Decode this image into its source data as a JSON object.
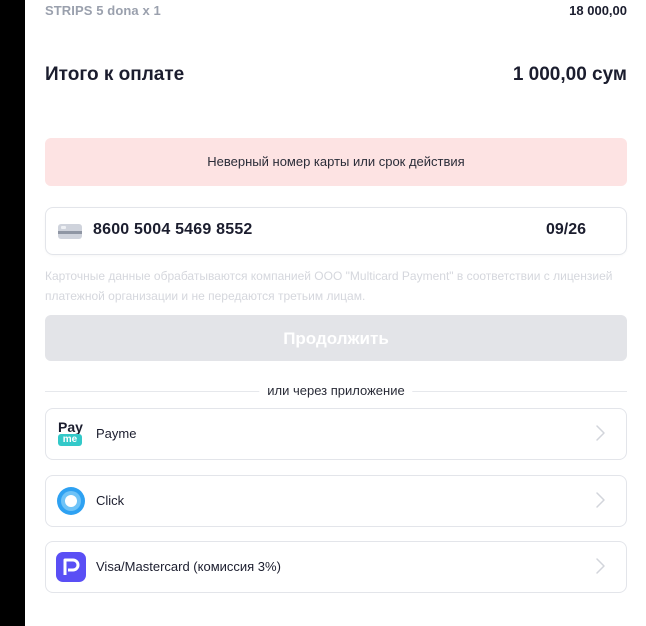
{
  "order": {
    "item_name": "STRIPS 5 dona x 1",
    "item_price": "18 000,00",
    "total_label": "Итого к оплате",
    "total_amount": "1 000,00 сум"
  },
  "error": {
    "message": "Неверный номер карты или срок действия"
  },
  "card": {
    "number": "8600 5004 5469 8552",
    "expiry": "09/26"
  },
  "disclaimer": "Карточные данные обрабатываются компанией ООО \"Multicard Payment\" в соответствии с лицензией платежной организации и не передаются третьим лицам.",
  "continue_label": "Продолжить",
  "divider_text": "или через приложение",
  "payment_options": [
    {
      "label": "Payme",
      "icon": "payme-logo",
      "logo_text_top": "Pay",
      "logo_text_bottom": "me"
    },
    {
      "label": "Click",
      "icon": "click-logo"
    },
    {
      "label": "Visa/Mastercard (комиссия 3%)",
      "icon": "multicard-logo"
    }
  ],
  "colors": {
    "error_bg": "#fde3e3",
    "button_disabled": "#e3e4e8",
    "payme_accent": "#33c9c9",
    "click_blue": "#2ea1f2",
    "multicard_purple": "#5a4ff5"
  }
}
